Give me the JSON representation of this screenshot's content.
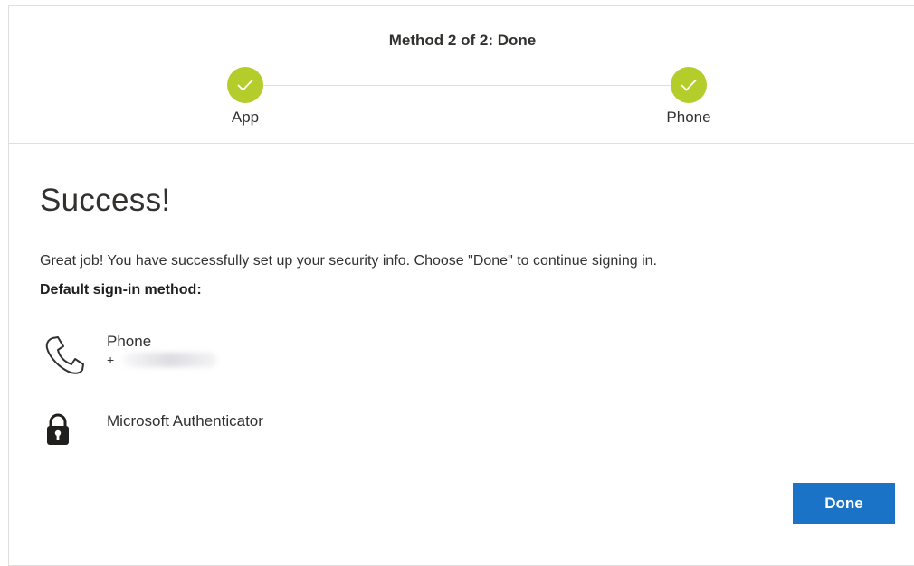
{
  "header": {
    "step_title": "Method 2 of 2: Done",
    "steps": [
      {
        "label": "App",
        "status": "complete"
      },
      {
        "label": "Phone",
        "status": "complete"
      }
    ],
    "step_color": "#b4cd2a"
  },
  "content": {
    "title": "Success!",
    "message": "Great job! You have successfully set up your security info. Choose \"Done\" to continue signing in.",
    "default_label": "Default sign-in method:",
    "methods": [
      {
        "icon": "phone-icon",
        "name": "Phone",
        "detail_prefix": "+"
      },
      {
        "icon": "authenticator-lock-icon",
        "name": "Microsoft Authenticator"
      }
    ]
  },
  "actions": {
    "done_label": "Done",
    "button_color": "#1a73c7"
  }
}
